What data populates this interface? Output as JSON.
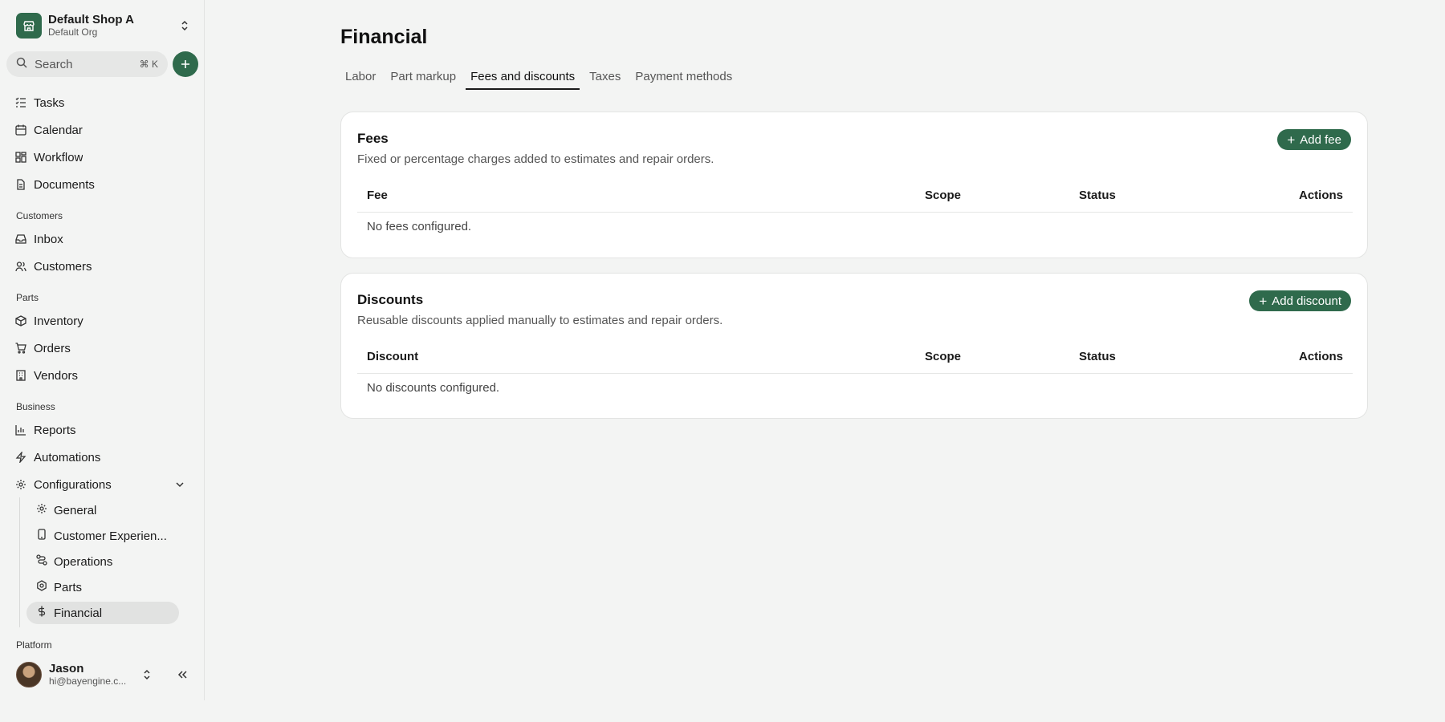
{
  "shop": {
    "name": "Default Shop A",
    "org": "Default Org"
  },
  "search": {
    "placeholder": "Search",
    "shortcut": "⌘ K"
  },
  "nav": {
    "main": [
      {
        "label": "Tasks",
        "icon": "tasks-icon"
      },
      {
        "label": "Calendar",
        "icon": "calendar-icon"
      },
      {
        "label": "Workflow",
        "icon": "workflow-icon"
      },
      {
        "label": "Documents",
        "icon": "documents-icon"
      }
    ],
    "customers_label": "Customers",
    "customers": [
      {
        "label": "Inbox",
        "icon": "inbox-icon"
      },
      {
        "label": "Customers",
        "icon": "customers-icon"
      }
    ],
    "parts_label": "Parts",
    "parts": [
      {
        "label": "Inventory",
        "icon": "inventory-icon"
      },
      {
        "label": "Orders",
        "icon": "cart-icon"
      },
      {
        "label": "Vendors",
        "icon": "vendors-icon"
      }
    ],
    "business_label": "Business",
    "business": [
      {
        "label": "Reports",
        "icon": "chart-icon"
      },
      {
        "label": "Automations",
        "icon": "bolt-icon"
      },
      {
        "label": "Configurations",
        "icon": "gear-icon"
      }
    ],
    "config_sub": [
      {
        "label": "General",
        "icon": "gear-icon"
      },
      {
        "label": "Customer Experien...",
        "icon": "phone-icon"
      },
      {
        "label": "Operations",
        "icon": "operations-icon"
      },
      {
        "label": "Parts",
        "icon": "parts-icon"
      },
      {
        "label": "Financial",
        "icon": "dollar-icon"
      }
    ],
    "platform_label": "Platform"
  },
  "user": {
    "name": "Jason",
    "email": "hi@bayengine.c..."
  },
  "page": {
    "title": "Financial",
    "tabs": [
      "Labor",
      "Part markup",
      "Fees and discounts",
      "Taxes",
      "Payment methods"
    ],
    "active_tab": "Fees and discounts"
  },
  "fees": {
    "title": "Fees",
    "description": "Fixed or percentage charges added to estimates and repair orders.",
    "button": "Add fee",
    "columns": [
      "Fee",
      "Scope",
      "Status",
      "Actions"
    ],
    "empty": "No fees configured."
  },
  "discounts": {
    "title": "Discounts",
    "description": "Reusable discounts applied manually to estimates and repair orders.",
    "button": "Add discount",
    "columns": [
      "Discount",
      "Scope",
      "Status",
      "Actions"
    ],
    "empty": "No discounts configured."
  },
  "colors": {
    "accent": "#2f6a4c",
    "background": "#f3f4f3",
    "card": "#ffffff"
  }
}
